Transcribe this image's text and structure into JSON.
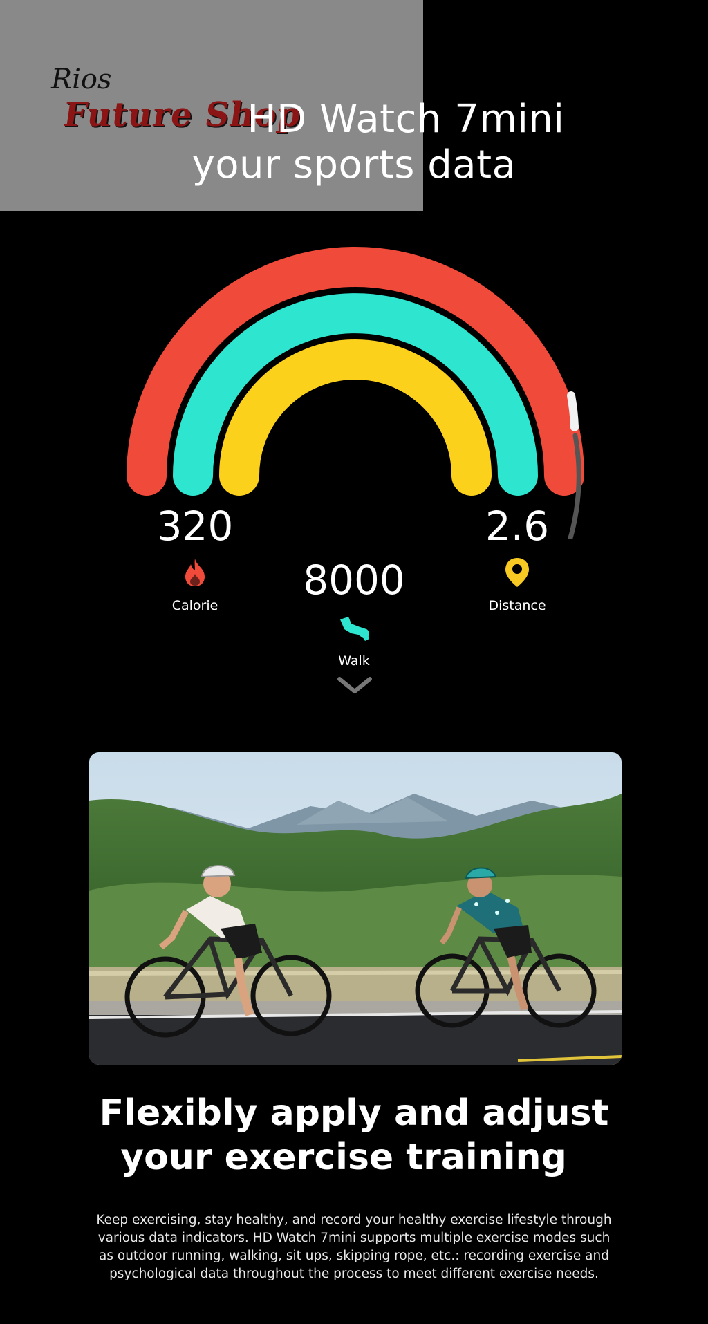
{
  "watermark": {
    "brand_top": "Rios",
    "brand_main": "Future Shop"
  },
  "header": {
    "line1": "HD Watch 7mini",
    "line2": "your sports data"
  },
  "metrics": {
    "calorie": {
      "value": "320",
      "label": "Calorie",
      "icon": "flame-icon",
      "color": "#f04a3a"
    },
    "walk": {
      "value": "8000",
      "label": "Walk",
      "icon": "shoe-icon",
      "color": "#2ee6cf"
    },
    "distance": {
      "value": "2.6",
      "label": "Distance",
      "icon": "location-pin-icon",
      "color": "#f7c922"
    }
  },
  "rings": {
    "outer_color": "#f04a3a",
    "middle_color": "#2ee6cf",
    "inner_color": "#fcd11c"
  },
  "scroll_indicator": {
    "icon": "chevron-down-icon"
  },
  "photo": {
    "subject": "cycling-photo"
  },
  "section2": {
    "title_line1": "Flexibly apply and adjust",
    "title_line2": "your exercise training",
    "body_lines": [
      "Keep exercising, stay healthy, and record your healthy exercise lifestyle through",
      "various data indicators. HD Watch 7mini supports multiple exercise modes such",
      "as outdoor running, walking, sit ups, skipping rope, etc.: recording exercise and",
      "psychological data throughout the process to meet different exercise needs."
    ]
  }
}
